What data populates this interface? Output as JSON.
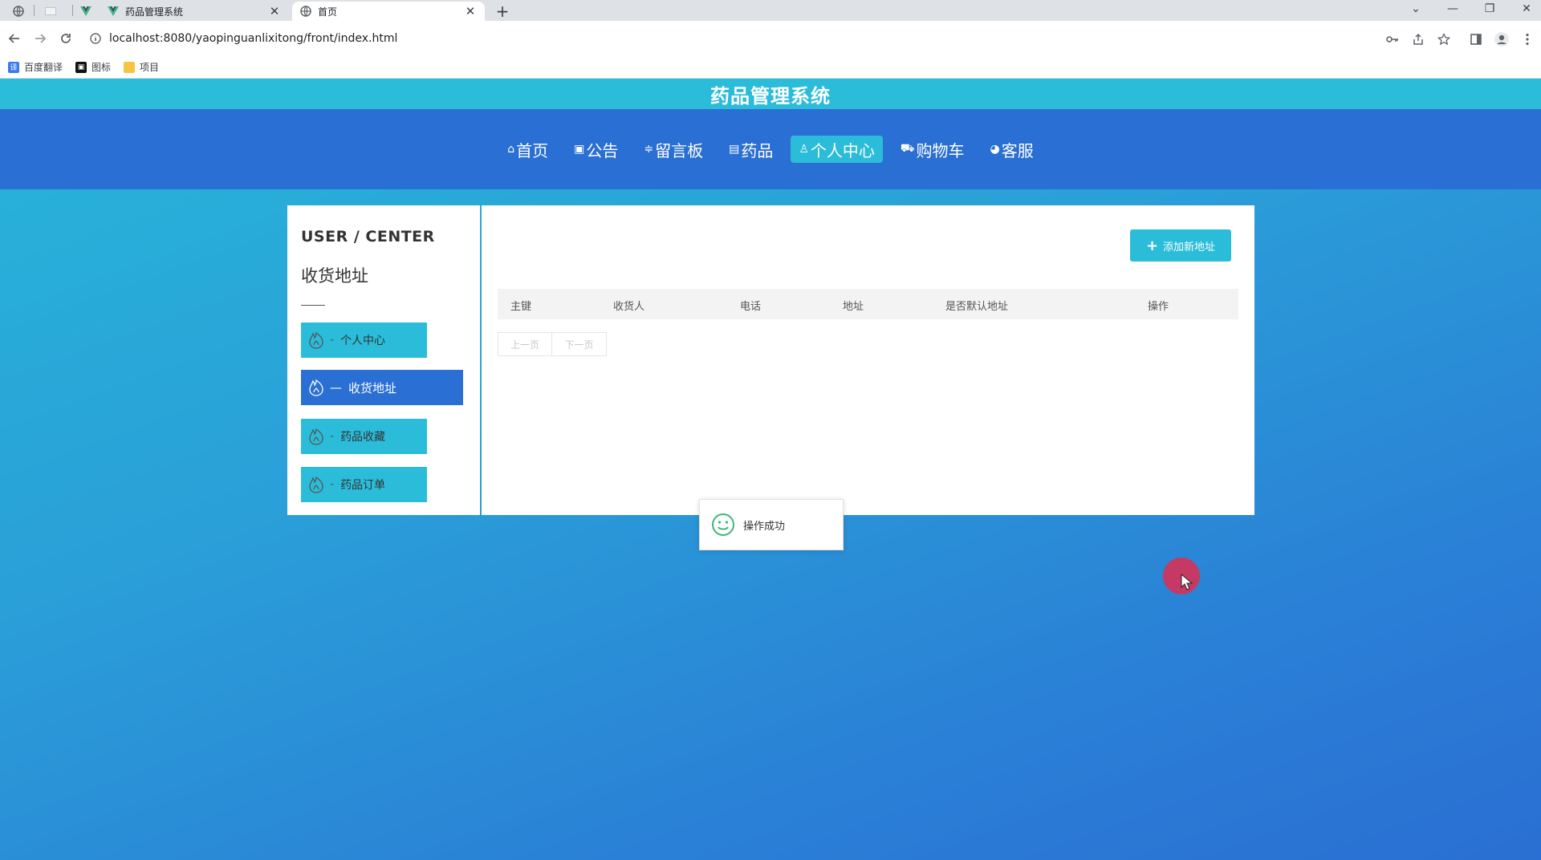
{
  "browser": {
    "tabs": [
      {
        "title": "药品管理系统",
        "close": "✕"
      },
      {
        "title": "首页",
        "close": "✕"
      }
    ],
    "new_tab": "+",
    "url": "localhost:8080/yaopinguanlixitong/front/index.html",
    "bookmarks": [
      "百度翻译",
      "图标",
      "项目"
    ],
    "window_controls": {
      "minimize": "—",
      "restore": "❐",
      "close": "✕",
      "dropdown": "⌄"
    }
  },
  "site": {
    "title": "药品管理系统",
    "nav": [
      {
        "icon": "home-icon",
        "glyph": "⌂",
        "label": "首页"
      },
      {
        "icon": "notice-icon",
        "glyph": "▣",
        "label": "公告"
      },
      {
        "icon": "message-icon",
        "glyph": "≑",
        "label": "留言板"
      },
      {
        "icon": "medicine-icon",
        "glyph": "▤",
        "label": "药品"
      },
      {
        "icon": "user-icon",
        "glyph": "♙",
        "label": "个人中心",
        "active": true
      },
      {
        "icon": "cart-icon",
        "glyph": "⛟",
        "label": "购物车"
      },
      {
        "icon": "service-icon",
        "glyph": "◕",
        "label": "客服"
      }
    ]
  },
  "user_center": {
    "title": "USER / CENTER",
    "subtitle": "收货地址",
    "menu": [
      {
        "label": "个人中心",
        "active": false
      },
      {
        "label": "收货地址",
        "active": true
      },
      {
        "label": "药品收藏",
        "active": false
      },
      {
        "label": "药品订单",
        "active": false
      }
    ]
  },
  "main": {
    "add_button": "添加新地址",
    "table": {
      "columns": [
        "主键",
        "收货人",
        "电话",
        "地址",
        "是否默认地址",
        "操作"
      ],
      "rows": []
    },
    "pager": {
      "prev": "上一页",
      "next": "下一页"
    }
  },
  "toast": {
    "message": "操作成功",
    "icon": "smile-icon"
  },
  "colors": {
    "accent": "#2bbcd9",
    "nav_bg": "#2a6fd3",
    "active_menu": "#2a6fd3",
    "cursor_highlight": "#c43a64"
  }
}
